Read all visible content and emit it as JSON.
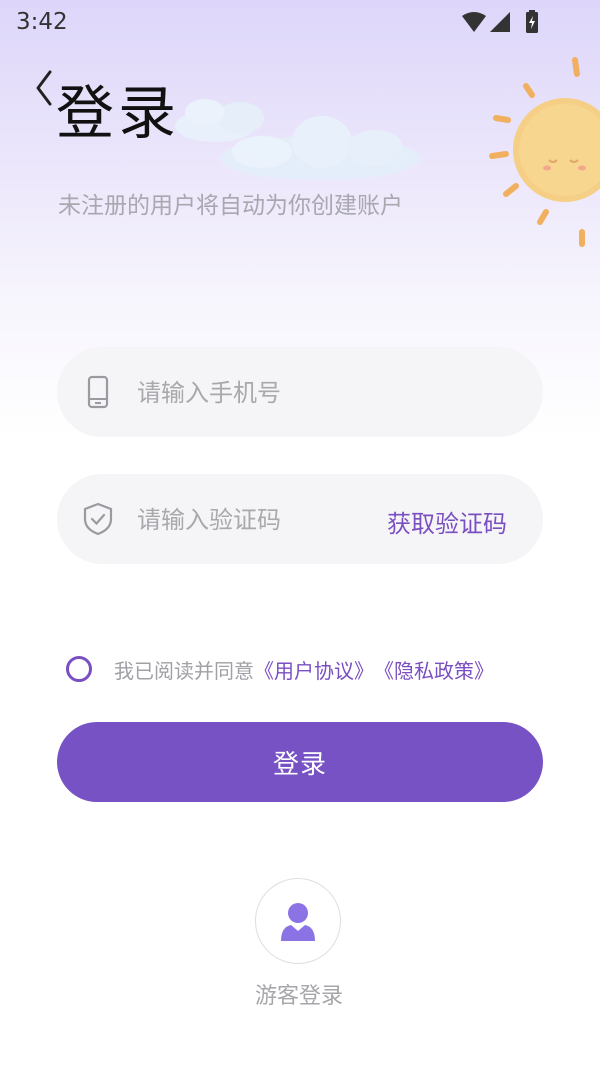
{
  "status_bar": {
    "time": "3:42"
  },
  "header": {
    "title": "登录",
    "subtitle": "未注册的用户将自动为你创建账户"
  },
  "form": {
    "phone": {
      "placeholder": "请输入手机号",
      "value": "",
      "icon": "phone-icon"
    },
    "code": {
      "placeholder": "请输入验证码",
      "value": "",
      "icon": "shield-check-icon",
      "get_code_label": "获取验证码"
    }
  },
  "agreement": {
    "checked": false,
    "text": "我已阅读并同意",
    "user_agreement": "《用户协议》",
    "privacy_policy": "《隐私政策》"
  },
  "login_button": {
    "label": "登录"
  },
  "guest": {
    "label": "游客登录",
    "icon": "user-icon"
  },
  "colors": {
    "accent": "#7752c4",
    "link": "#7a4fc2",
    "field_bg": "#f5f5f7"
  }
}
